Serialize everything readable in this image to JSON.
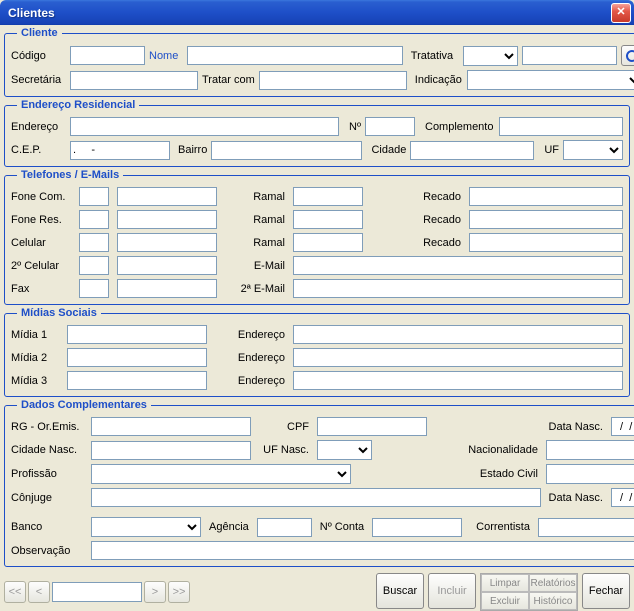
{
  "window": {
    "title": "Clientes"
  },
  "groups": {
    "cliente": "Cliente",
    "endereco": "Endereço Residencial",
    "telefones": "Telefones / E-Mails",
    "midias": "Mídias Sociais",
    "dados": "Dados Complementares"
  },
  "cliente": {
    "codigo_label": "Código",
    "nome_label": "Nome",
    "tratativa_label": "Tratativa",
    "secretaria_label": "Secretária",
    "tratar_com_label": "Tratar com",
    "indicacao_label": "Indicação",
    "codigo": "",
    "nome": "",
    "tratativa": "",
    "tratativa2": "",
    "secretaria": "",
    "tratar_com": "",
    "indicacao": ""
  },
  "endereco": {
    "endereco_label": "Endereço",
    "numero_label": "Nº",
    "complemento_label": "Complemento",
    "cep_label": "C.E.P.",
    "cep_sep": ".     -",
    "bairro_label": "Bairro",
    "cidade_label": "Cidade",
    "uf_label": "UF",
    "endereco": "",
    "numero": "",
    "complemento": "",
    "cep": "",
    "bairro": "",
    "cidade": "",
    "uf": ""
  },
  "telefones": {
    "fone_com_label": "Fone Com.",
    "fone_res_label": "Fone Res.",
    "celular_label": "Celular",
    "celular2_label": "2º Celular",
    "fax_label": "Fax",
    "ramal_label": "Ramal",
    "recado_label": "Recado",
    "email_label": "E-Mail",
    "email2_label": "2ª E-Mail",
    "fone_com_ddd": "",
    "fone_com": "",
    "fone_com_ramal": "",
    "fone_com_recado": "",
    "fone_res_ddd": "",
    "fone_res": "",
    "fone_res_ramal": "",
    "fone_res_recado": "",
    "celular_ddd": "",
    "celular": "",
    "celular_ramal": "",
    "celular_recado": "",
    "celular2_ddd": "",
    "celular2": "",
    "email": "",
    "fax_ddd": "",
    "fax": "",
    "email2": ""
  },
  "midias": {
    "midia1_label": "Mídia 1",
    "midia2_label": "Mídia 2",
    "midia3_label": "Mídia 3",
    "endereco_label": "Endereço",
    "midia1": "",
    "end1": "",
    "midia2": "",
    "end2": "",
    "midia3": "",
    "end3": ""
  },
  "dados": {
    "rg_label": "RG - Or.Emis.",
    "cpf_label": "CPF",
    "data_nasc_label": "Data Nasc.",
    "cidade_nasc_label": "Cidade  Nasc.",
    "uf_nasc_label": "UF Nasc.",
    "nacionalidade_label": "Nacionalidade",
    "profissao_label": "Profissão",
    "estado_civil_label": "Estado Civil",
    "conjuge_label": "Cônjuge",
    "data_nasc2_label": "Data Nasc.",
    "banco_label": "Banco",
    "agencia_label": "Agência",
    "conta_label": "Nº Conta",
    "correntista_label": "Correntista",
    "obs_label": "Observação",
    "rg": "",
    "cpf": "",
    "data_nasc": "  /  /",
    "cidade_nasc": "",
    "uf_nasc": "",
    "nacionalidade": "",
    "profissao": "",
    "estado_civil": "",
    "conjuge": "",
    "data_nasc2": "  /  /",
    "banco": "",
    "agencia": "",
    "conta": "",
    "correntista": "",
    "obs": ""
  },
  "buttons": {
    "buscar": "Buscar",
    "incluir": "Incluir",
    "limpar": "Limpar",
    "relatorios": "Relatórios",
    "excluir": "Excluir",
    "historico": "Histórico",
    "fechar": "Fechar",
    "nav_first": "<<",
    "nav_prev": "<",
    "nav_next": ">",
    "nav_last": ">>"
  }
}
